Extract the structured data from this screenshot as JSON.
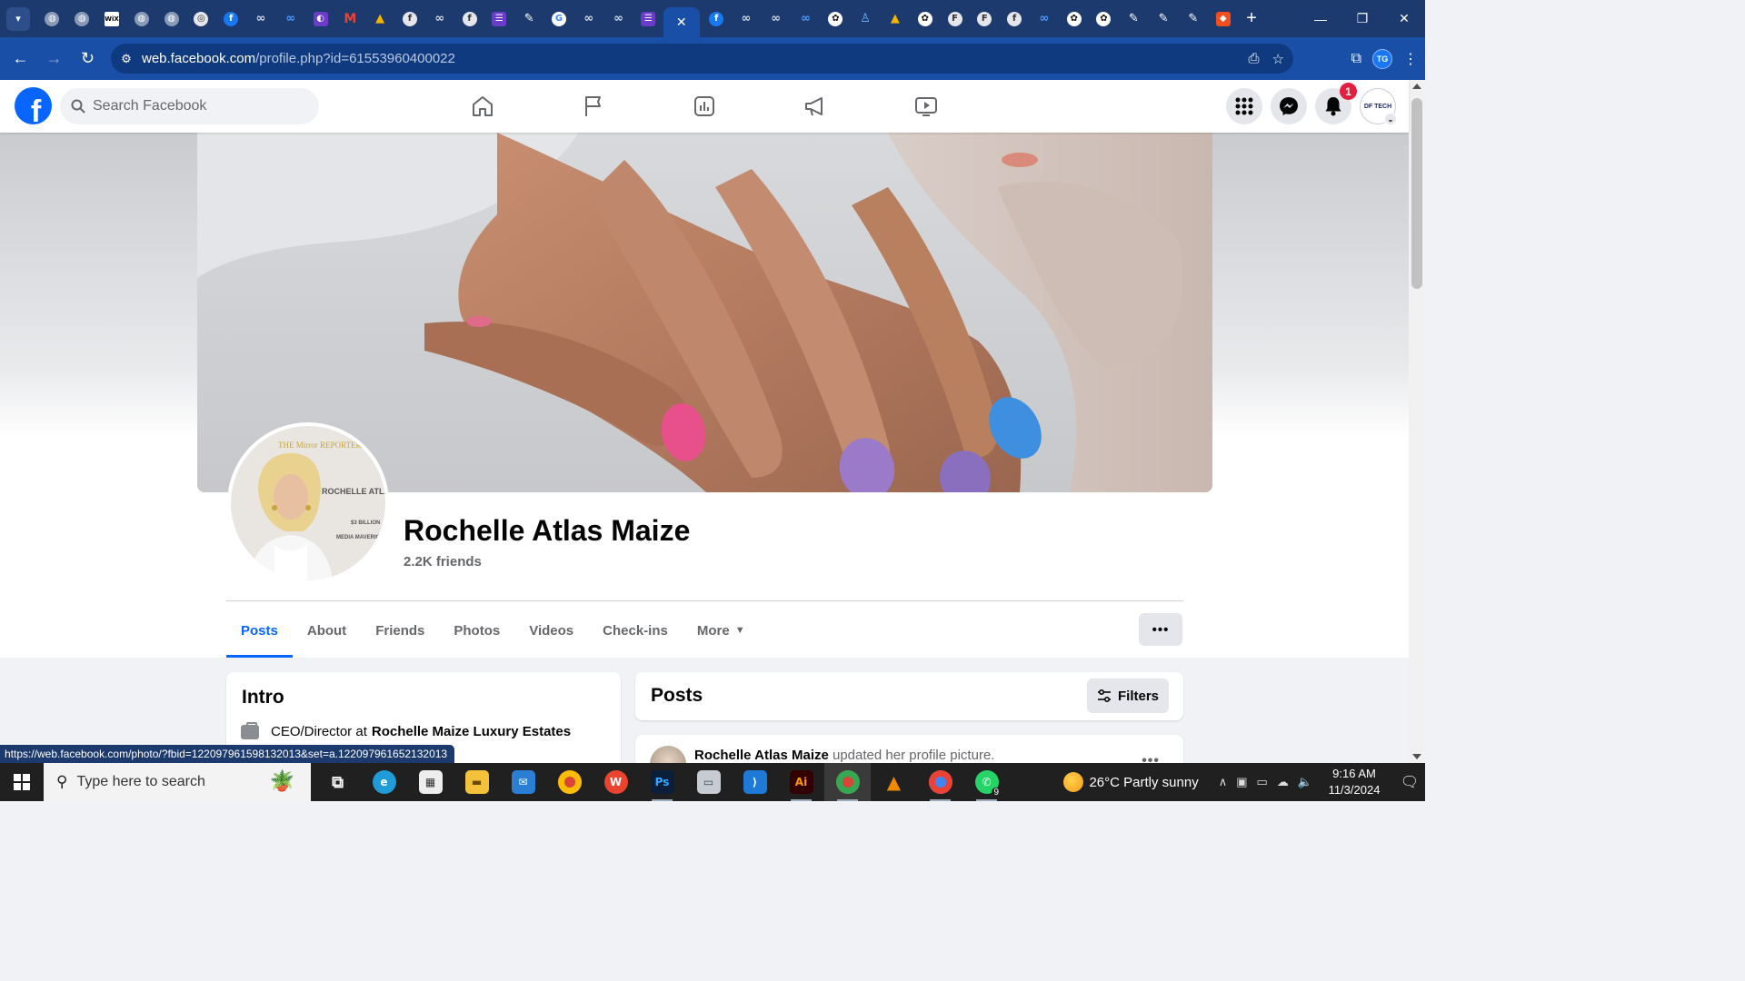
{
  "browser": {
    "active_tab_close": "✕",
    "new_tab": "+",
    "window_controls": [
      "—",
      "❐",
      "✕"
    ],
    "url_host": "web.facebook.com",
    "url_path": "/profile.php?id=61553960400022",
    "profile_initials": "TG",
    "status_url": "https://web.facebook.com/photo/?fbid=122097961598132013&set=a.122097961652132013"
  },
  "tabs": [
    {
      "icon": "globe",
      "g": "◍"
    },
    {
      "icon": "globe",
      "g": "◍"
    },
    {
      "icon": "wix",
      "g": "WiX"
    },
    {
      "icon": "globe",
      "g": "◍"
    },
    {
      "icon": "globe",
      "g": "◍"
    },
    {
      "icon": "gray",
      "g": "◎"
    },
    {
      "icon": "fb",
      "g": "f"
    },
    {
      "icon": "meta",
      "g": "∞"
    },
    {
      "icon": "metablue",
      "g": "∞"
    },
    {
      "icon": "purple",
      "g": "◐"
    },
    {
      "icon": "gmail",
      "g": "M"
    },
    {
      "icon": "drive",
      "g": "▲"
    },
    {
      "icon": "gray",
      "g": "f"
    },
    {
      "icon": "meta",
      "g": "∞"
    },
    {
      "icon": "gray",
      "g": "f"
    },
    {
      "icon": "purple",
      "g": "☰"
    },
    {
      "icon": "pen",
      "g": "✎"
    },
    {
      "icon": "google",
      "g": "G"
    },
    {
      "icon": "meta",
      "g": "∞"
    },
    {
      "icon": "meta",
      "g": "∞"
    },
    {
      "icon": "purple",
      "g": "☰"
    }
  ],
  "tabs_after": [
    {
      "icon": "fb",
      "g": "f"
    },
    {
      "icon": "meta",
      "g": "∞"
    },
    {
      "icon": "meta",
      "g": "∞"
    },
    {
      "icon": "metablue",
      "g": "∞"
    },
    {
      "icon": "chatgpt",
      "g": "✿"
    },
    {
      "icon": "person",
      "g": "♙"
    },
    {
      "icon": "drive",
      "g": "▲"
    },
    {
      "icon": "chatgpt",
      "g": "✿"
    },
    {
      "icon": "gray",
      "g": "F"
    },
    {
      "icon": "gray",
      "g": "F"
    },
    {
      "icon": "gray",
      "g": "f"
    },
    {
      "icon": "metablue",
      "g": "∞"
    },
    {
      "icon": "chatgpt",
      "g": "✿"
    },
    {
      "icon": "chatgpt",
      "g": "✿"
    },
    {
      "icon": "pen",
      "g": "✎"
    },
    {
      "icon": "pen",
      "g": "✎"
    },
    {
      "icon": "pen",
      "g": "✎"
    },
    {
      "icon": "fig",
      "g": "◆"
    }
  ],
  "facebook": {
    "logo": "f",
    "search_placeholder": "Search Facebook",
    "notification_count": "1",
    "account_label": "DF TECH",
    "nav": [
      "home-icon",
      "flag-icon",
      "dashboard-icon",
      "megaphone-icon",
      "video-icon"
    ]
  },
  "profile": {
    "name": "Rochelle Atlas Maize",
    "friends": "2.2K friends",
    "avatar_magazine": "THE Mirror REPORTER",
    "avatar_headline": "ROCHELLE ATLAS MAIZE",
    "avatar_tag1": "$3 BILLION",
    "avatar_tag2": "MEDIA MAVERICK",
    "tabs": [
      "Posts",
      "About",
      "Friends",
      "Photos",
      "Videos",
      "Check-ins",
      "More"
    ],
    "more_caret": "▼",
    "dots": "•••"
  },
  "intro": {
    "title": "Intro",
    "role": "CEO/Director at",
    "company": "Rochelle Maize Luxury Estates"
  },
  "posts": {
    "title": "Posts",
    "filters": "Filters",
    "first_author": "Rochelle Atlas Maize",
    "first_action": "updated her profile picture.",
    "more": "•••"
  },
  "taskbar": {
    "search_placeholder": "Type here to search",
    "whatsapp_count": "9",
    "weather": "26°C  Partly sunny",
    "time": "9:16 AM",
    "date": "11/3/2024"
  },
  "colors": {
    "fb_blue": "#0866ff",
    "chrome_frame": "#1d3a6e",
    "chrome_toolbar": "#1a4fa8",
    "badge_red": "#e41e3f"
  }
}
